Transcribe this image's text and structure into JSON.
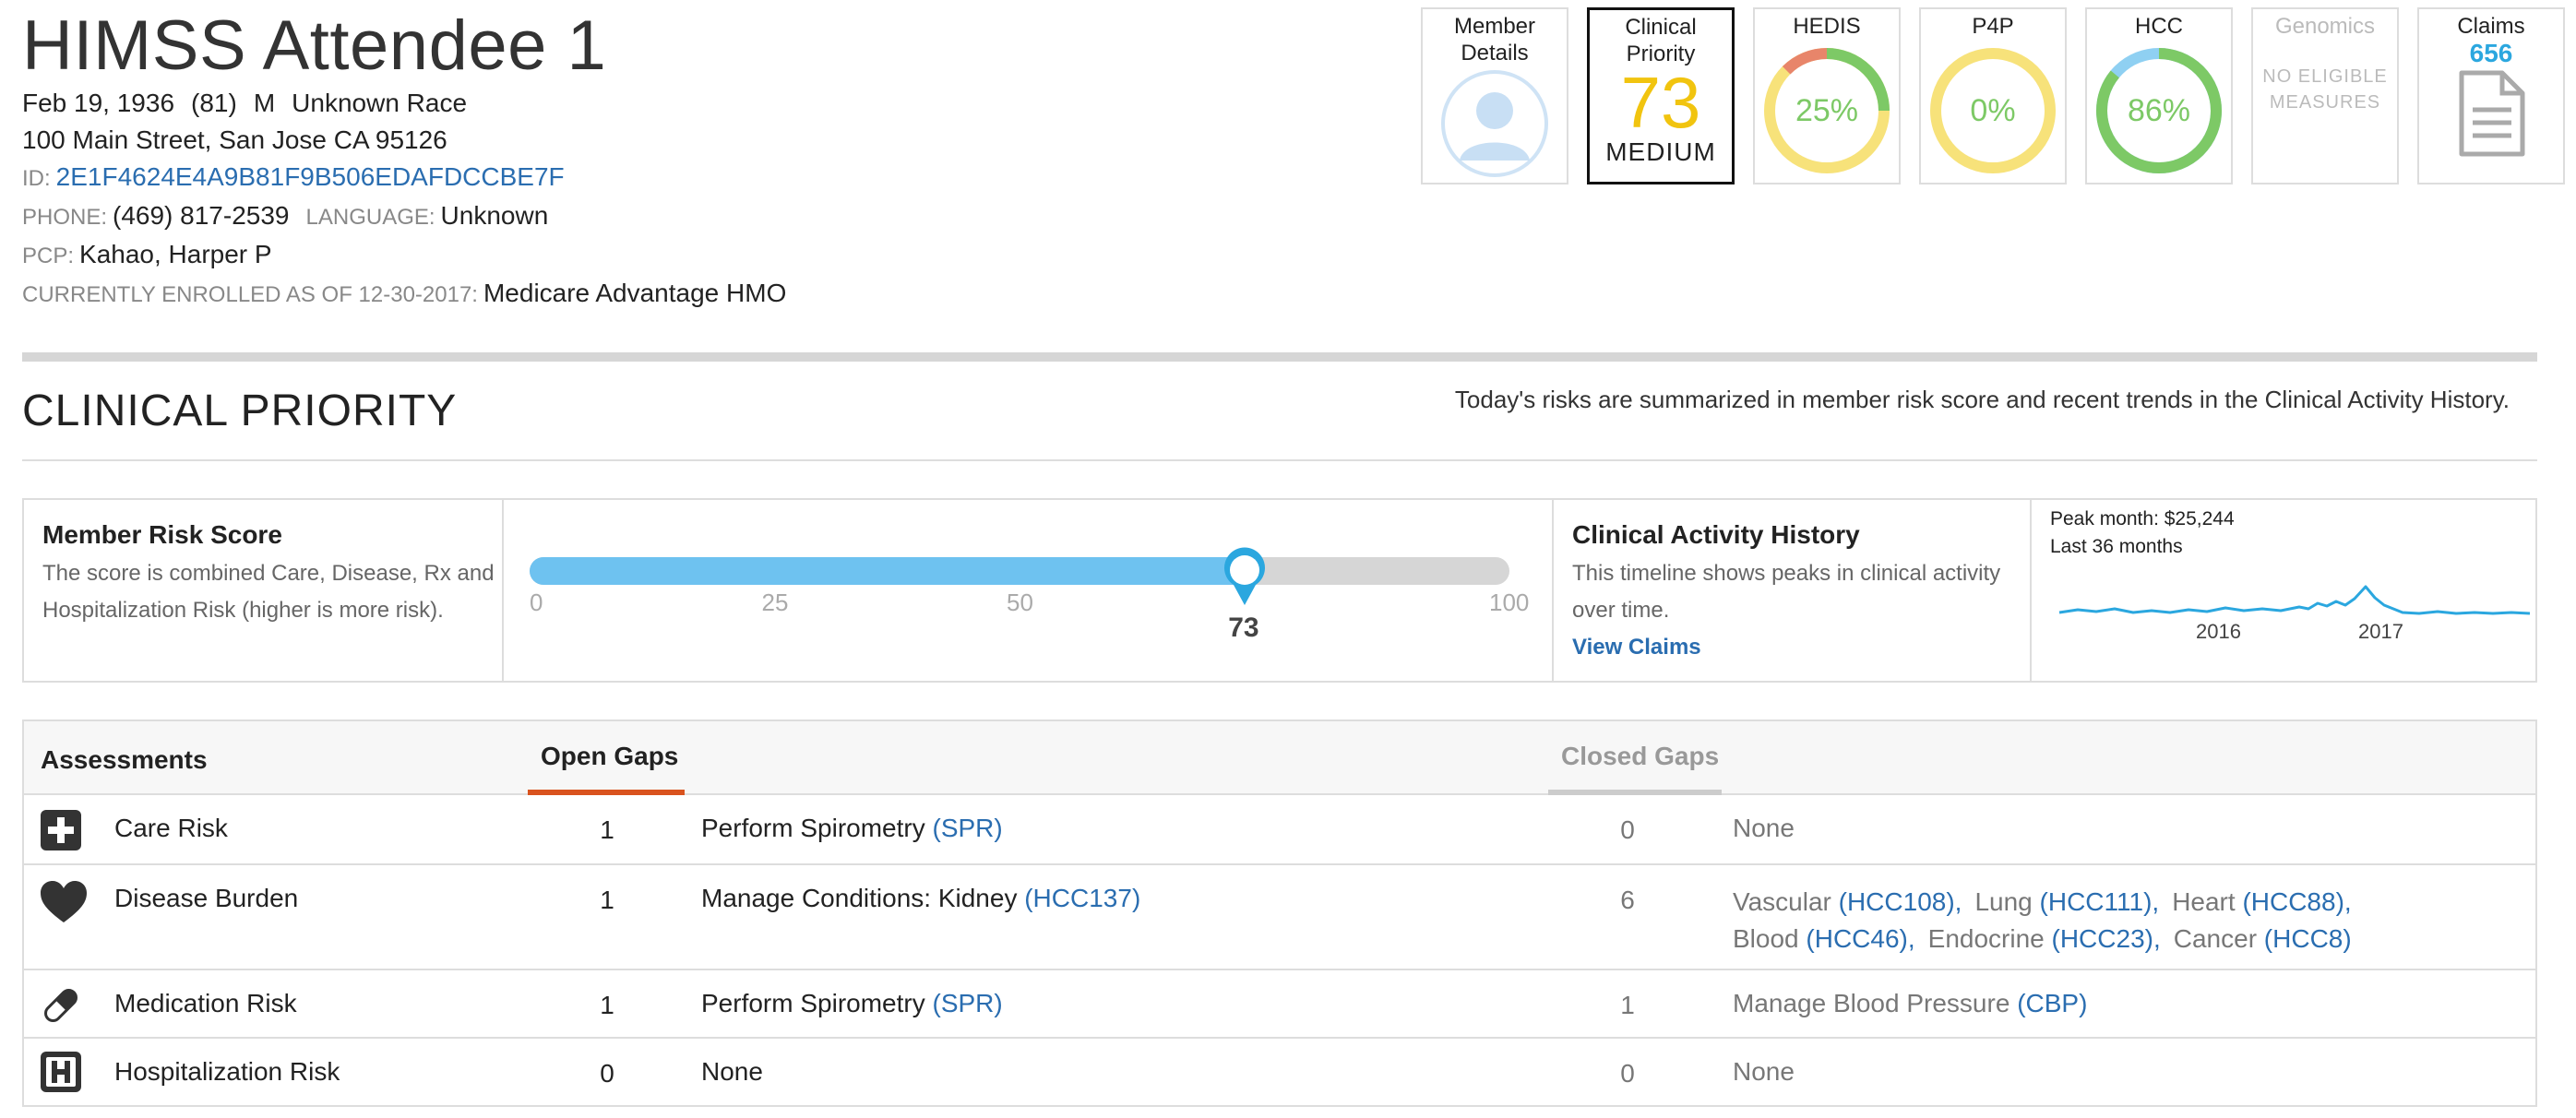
{
  "member": {
    "name": "HIMSS Attendee 1",
    "dob": "Feb 19, 1936",
    "age": "(81)",
    "sex": "M",
    "race": "Unknown Race",
    "address": "100 Main Street, San Jose CA 95126",
    "id_label": "ID:",
    "id": "2E1F4624E4A9B81F9B506EDAFDCCBE7F",
    "phone_label": "PHONE:",
    "phone": "(469) 817-2539",
    "language_label": "LANGUAGE:",
    "language": "Unknown",
    "pcp_label": "PCP:",
    "pcp": "Kahao, Harper P",
    "enrolled_label": "CURRENTLY ENROLLED AS OF 12-30-2017:",
    "enrolled": "Medicare Advantage HMO"
  },
  "tiles": {
    "member_details": {
      "label_line1": "Member",
      "label_line2": "Details",
      "icon": "user-avatar-icon"
    },
    "clinical_priority": {
      "label_line1": "Clinical",
      "label_line2": "Priority",
      "value": "73",
      "level": "MEDIUM",
      "value_color": "#f1c40f"
    },
    "hedis": {
      "label": "HEDIS",
      "value": "25%",
      "fraction": 0.25,
      "color": "#7dc966"
    },
    "p4p": {
      "label": "P4P",
      "value": "0%",
      "fraction": 0,
      "color": "#7dc966"
    },
    "hcc": {
      "label": "HCC",
      "value": "86%",
      "fraction": 0.86,
      "color": "#7dc966"
    },
    "genomics": {
      "label": "Genomics",
      "status_line1": "NO ELIGIBLE",
      "status_line2": "MEASURES"
    },
    "claims": {
      "label": "Claims",
      "value": "656",
      "icon": "document-icon"
    }
  },
  "section": {
    "title": "CLINICAL PRIORITY",
    "note": "Today's risks are summarized in member risk score and recent trends in the Clinical Activity History."
  },
  "risk_score": {
    "title": "Member Risk Score",
    "desc_line1": "The score is combined Care, Disease, Rx and",
    "desc_line2": "Hospitalization Risk (higher is more risk).",
    "value": 73,
    "value_label": "73",
    "ticks": [
      "0",
      "25",
      "50",
      "100"
    ],
    "bar_color": "#6ec2f0",
    "track_color": "#d6d6d6"
  },
  "activity": {
    "title": "Clinical Activity History",
    "desc_line1": "This timeline shows peaks in clinical activity",
    "desc_line2": "over time.",
    "link": "View Claims",
    "peak": "Peak month: $25,244",
    "range": "Last 36 months",
    "years": [
      "2016",
      "2017"
    ],
    "line_color": "#2ba7df"
  },
  "assessments": {
    "header_label": "Assessments",
    "open_tab": "Open Gaps",
    "closed_tab": "Closed Gaps",
    "open_tab_color": "#d9531e",
    "rows": [
      {
        "icon": "care-plus-icon",
        "name": "Care Risk",
        "open_count": "1",
        "open_text": "Perform Spirometry",
        "open_code": "(SPR)",
        "closed_count": "0",
        "closed_text": "None"
      },
      {
        "icon": "heart-icon",
        "name": "Disease Burden",
        "open_count": "1",
        "open_text": "Manage Conditions: Kidney",
        "open_code": "(HCC137)",
        "closed_count": "6",
        "closed_items": [
          {
            "label": "Vascular",
            "code": "(HCC108),"
          },
          {
            "label": "Lung",
            "code": "(HCC111),"
          },
          {
            "label": "Heart",
            "code": "(HCC88),"
          },
          {
            "label": "Blood",
            "code": "(HCC46),"
          },
          {
            "label": "Endocrine",
            "code": "(HCC23),"
          },
          {
            "label": "Cancer",
            "code": "(HCC8)"
          }
        ]
      },
      {
        "icon": "pill-icon",
        "name": "Medication Risk",
        "open_count": "1",
        "open_text": "Perform Spirometry",
        "open_code": "(SPR)",
        "closed_count": "1",
        "closed_text": "Manage Blood Pressure",
        "closed_code": "(CBP)"
      },
      {
        "icon": "hospital-icon",
        "name": "Hospitalization Risk",
        "open_count": "0",
        "open_text": "None",
        "closed_count": "0",
        "closed_text": "None"
      }
    ]
  }
}
